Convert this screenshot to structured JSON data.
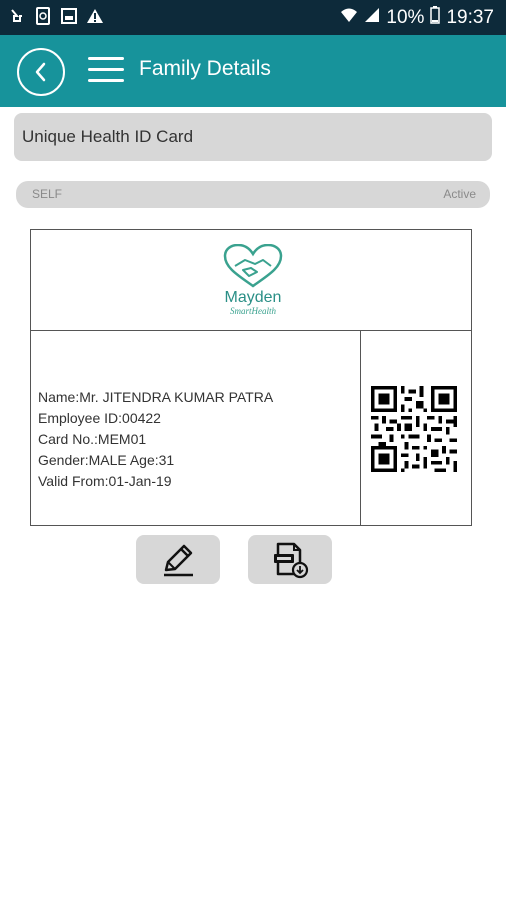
{
  "status_bar": {
    "battery": "10%",
    "time": "19:37",
    "icons": [
      "download-icon",
      "sync-icon",
      "image-icon",
      "warning-icon",
      "wifi-icon",
      "signal-icon",
      "battery-icon"
    ]
  },
  "app_bar": {
    "title": "Family Details",
    "color": "#17939b"
  },
  "section": {
    "title": "Unique Health ID Card"
  },
  "member": {
    "relation": "SELF",
    "status": "Active"
  },
  "card": {
    "logo_name": "Mayden",
    "logo_tagline": "SmartHealth",
    "name": "Name:Mr. JITENDRA KUMAR PATRA",
    "employee_id": "Employee ID:00422",
    "card_no": "Card No.:MEM01",
    "gender_age": "Gender:MALE Age:31",
    "valid_from": "Valid From:01-Jan-19"
  },
  "actions": {
    "edit_icon": "pencil-icon",
    "pdf_icon": "pdf-download-icon"
  }
}
